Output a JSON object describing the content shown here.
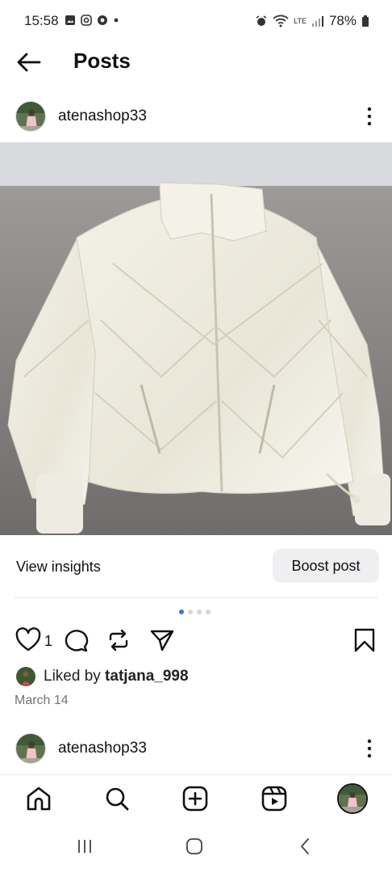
{
  "status_bar": {
    "time": "15:58",
    "battery": "78%",
    "network_label": "LTE"
  },
  "header": {
    "title": "Posts"
  },
  "post": {
    "username": "atenashop33",
    "image_description_icon": "jacket-photo",
    "insights_label": "View insights",
    "boost_label": "Boost post",
    "carousel_total": 4,
    "carousel_active": 1,
    "like_count": "1",
    "liked_by_prefix": "Liked by ",
    "liked_by_user": "tatjana_998",
    "date": "March 14"
  },
  "next_post": {
    "username": "atenashop33"
  },
  "bottom_nav": {
    "items": [
      "home-icon",
      "search-icon",
      "create-icon",
      "reels-icon",
      "profile-avatar"
    ]
  },
  "colors": {
    "accent_dot": "#3d6ff6",
    "boost_bg": "#efeff1",
    "date_gray": "#737373"
  }
}
